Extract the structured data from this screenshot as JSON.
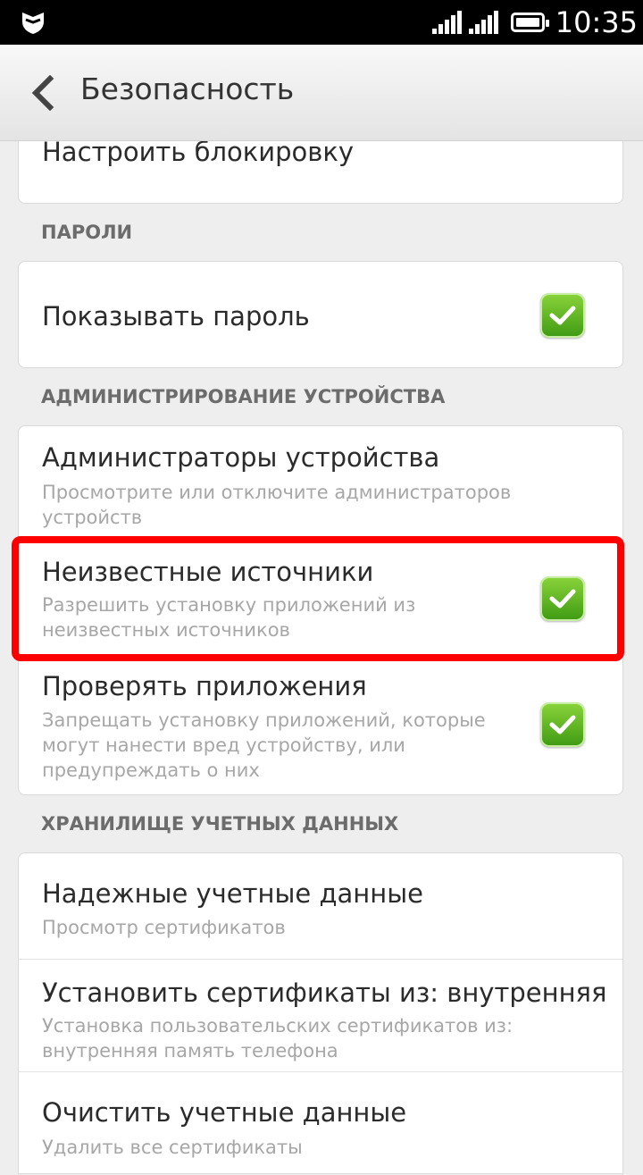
{
  "status_bar": {
    "time": "10:35"
  },
  "header": {
    "title": "Безопасность"
  },
  "items": {
    "lock_setup": {
      "title": "Настроить блокировку"
    },
    "show_password": {
      "title": "Показывать пароль",
      "checked": true
    },
    "device_admins": {
      "title": "Администраторы устройства",
      "subtitle": "Просмотрите или отключите администраторов устройств"
    },
    "unknown_sources": {
      "title": "Неизвестные источники",
      "subtitle": "Разрешить установку приложений из неизвестных источников",
      "checked": true
    },
    "verify_apps": {
      "title": "Проверять приложения",
      "subtitle": "Запрещать установку приложений, которые могут нанести вред устройству, или предупреждать о них",
      "checked": true
    },
    "trusted_creds": {
      "title": "Надежные учетные данные",
      "subtitle": "Просмотр сертификатов"
    },
    "install_certs": {
      "title": "Установить сертификаты из: внутренняя",
      "subtitle": "Установка пользовательских сертификатов из: внутренняя память телефона"
    },
    "clear_creds": {
      "title": "Очистить учетные данные",
      "subtitle": "Удалить все сертификаты"
    }
  },
  "sections": {
    "passwords": "ПАРОЛИ",
    "device_admin": "АДМИНИСТРИРОВАНИЕ УСТРОЙСТВА",
    "credential_storage": "ХРАНИЛИЩЕ УЧЕТНЫХ ДАННЫХ"
  },
  "colors": {
    "highlight": "#ff0000",
    "checkbox": "#5cb824"
  },
  "icons": {
    "back": "chevron-left-icon",
    "checkbox": "check-icon",
    "status_left": "shield-icon"
  }
}
